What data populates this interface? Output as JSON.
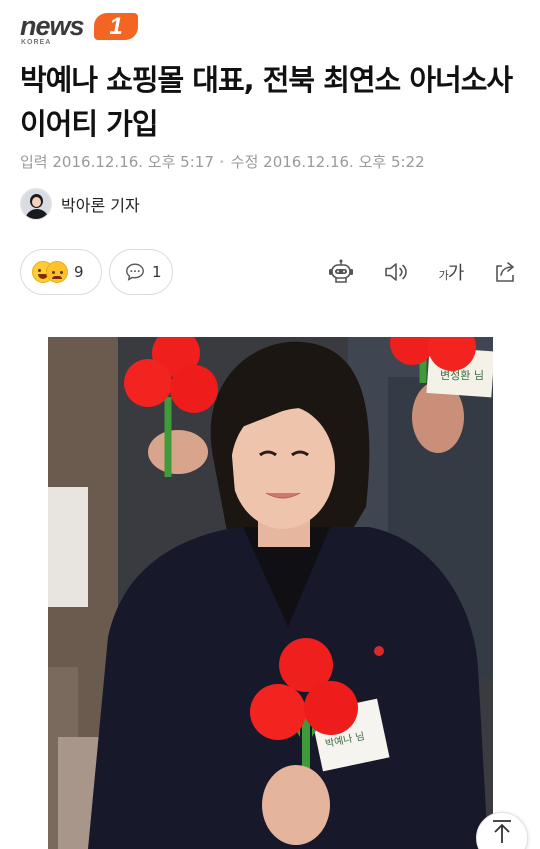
{
  "brand": {
    "logo_word": "news",
    "logo_badge": "1",
    "logo_sub": "KOREA",
    "accent_color": "#f26522"
  },
  "article": {
    "headline": "박예나 쇼핑몰 대표, 전북 최연소 아너소사이어티 가입",
    "published_label": "입력",
    "published_value": "2016.12.16. 오후 5:17",
    "updated_label": "수정",
    "updated_value": "2016.12.16. 오후 5:22",
    "reporter": "박아론 기자"
  },
  "actions": {
    "reaction_count": "9",
    "comment_count": "1",
    "font_size_small": "가",
    "font_size_large": "가"
  },
  "icons": {
    "reaction": "emoji-reaction-icon",
    "comment": "speech-bubble-icon",
    "tts": "robot-icon",
    "audio": "speaker-icon",
    "font": "font-size-icon",
    "share": "share-icon",
    "top": "arrow-up-icon"
  },
  "photo": {
    "name_tag_text": "박예나 님",
    "name_tag_text_top": "변정환 님"
  }
}
